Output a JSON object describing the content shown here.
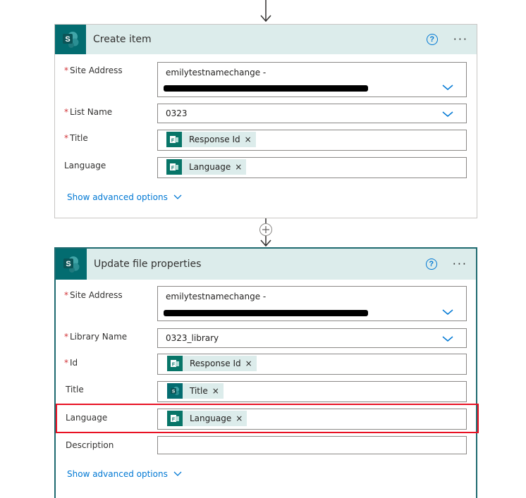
{
  "card1": {
    "title": "Create item",
    "help": "?",
    "more": "···",
    "fields": {
      "site_address": {
        "label": "Site Address",
        "value": "emilytestnamechange -"
      },
      "list_name": {
        "label": "List Name",
        "value": "0323"
      },
      "title": {
        "label": "Title",
        "token": "Response Id"
      },
      "language": {
        "label": "Language",
        "token": "Language"
      }
    },
    "advanced": "Show advanced options"
  },
  "card2": {
    "title": "Update file properties",
    "help": "?",
    "more": "···",
    "fields": {
      "site_address": {
        "label": "Site Address",
        "value": "emilytestnamechange -"
      },
      "library_name": {
        "label": "Library Name",
        "value": "0323_library"
      },
      "id": {
        "label": "Id",
        "token": "Response Id"
      },
      "title": {
        "label": "Title",
        "token": "Title"
      },
      "language": {
        "label": "Language",
        "token": "Language"
      },
      "description": {
        "label": "Description",
        "value": ""
      }
    },
    "advanced": "Show advanced options"
  },
  "required_mark": "*",
  "token_remove": "×",
  "icons": {
    "sharepoint": "sharepoint-logo-icon",
    "forms": "forms-token-icon",
    "chevron": "chevron-down-icon",
    "help": "help-icon",
    "more": "more-options-icon",
    "plus": "add-step-icon"
  },
  "colors": {
    "header_bg": "#dceceb",
    "sharepoint": "#036c70",
    "link": "#0078d4",
    "required": "#d13438",
    "highlight": "#e81123"
  }
}
